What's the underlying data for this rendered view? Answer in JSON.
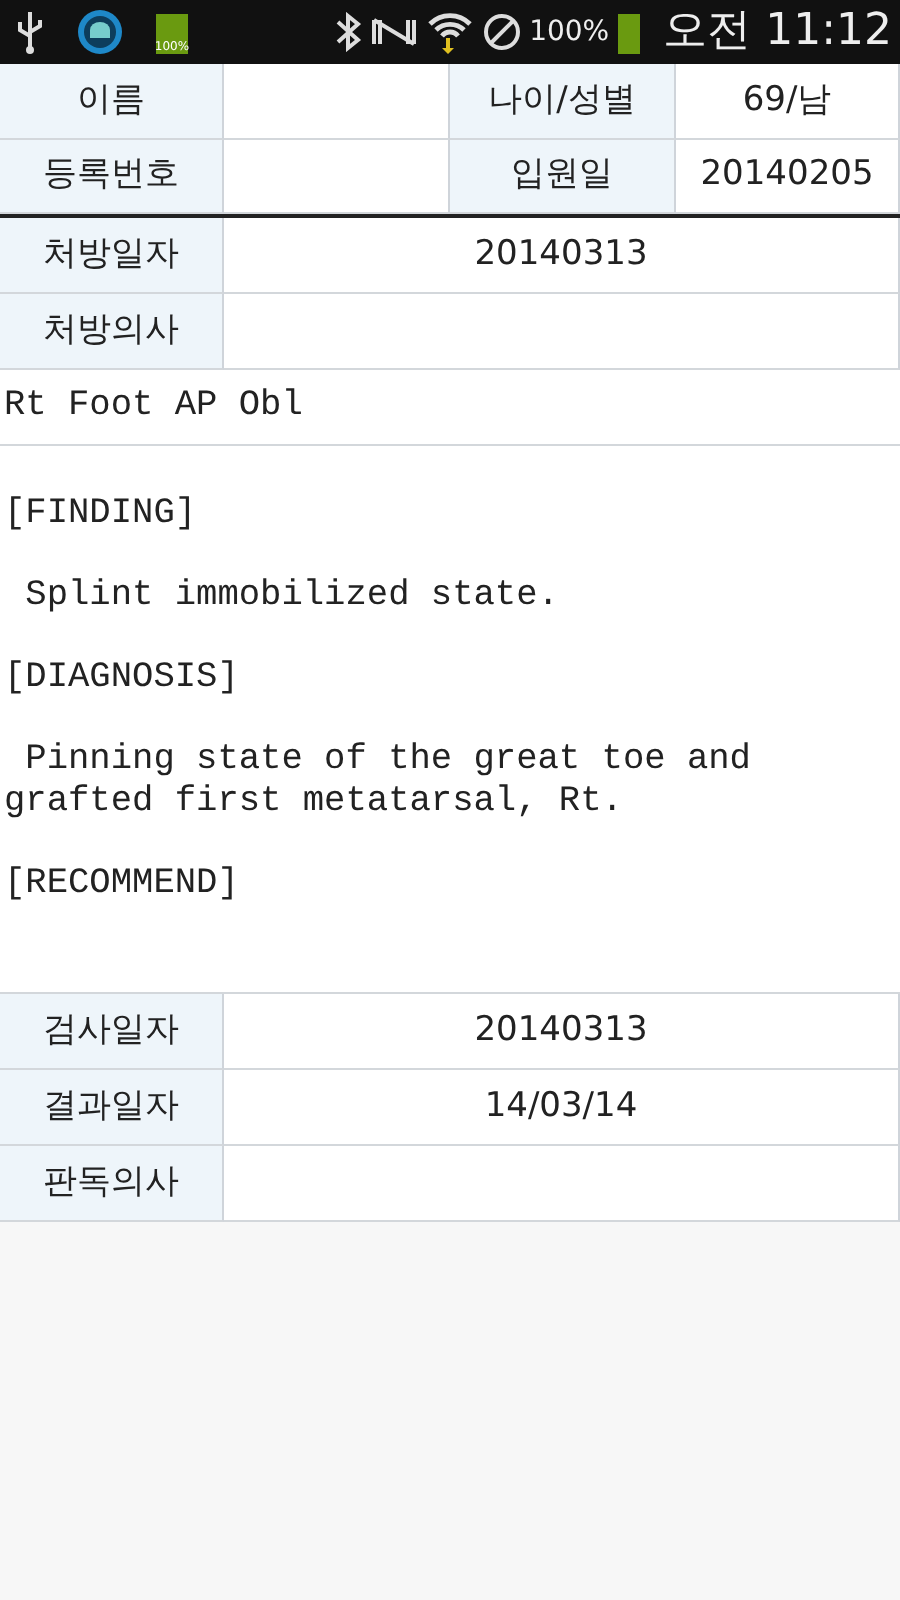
{
  "status_bar": {
    "battery_icon_label": "100%",
    "battery_percent": "100%",
    "time": "오전 11:12"
  },
  "patient": [
    {
      "label": "이름"
    },
    {
      "label": "나이/성별",
      "value": "69/남"
    },
    {
      "label": "등록번호"
    },
    {
      "label": "입원일",
      "value": "20140205"
    }
  ],
  "order": [
    {
      "label": "처방일자",
      "value": "20140313"
    },
    {
      "label": "처방의사"
    }
  ],
  "exam_title": "Rt Foot AP Obl",
  "report": [
    "[FINDING]",
    " Splint immobilized state.",
    "[DIAGNOSIS]",
    " Pinning state of the great toe and grafted first metatarsal, Rt.",
    "[RECOMMEND]"
  ],
  "result": [
    {
      "label": "검사일자",
      "value": "20140313"
    },
    {
      "label": "결과일자",
      "value": "14/03/14"
    },
    {
      "label": "판독의사"
    }
  ]
}
